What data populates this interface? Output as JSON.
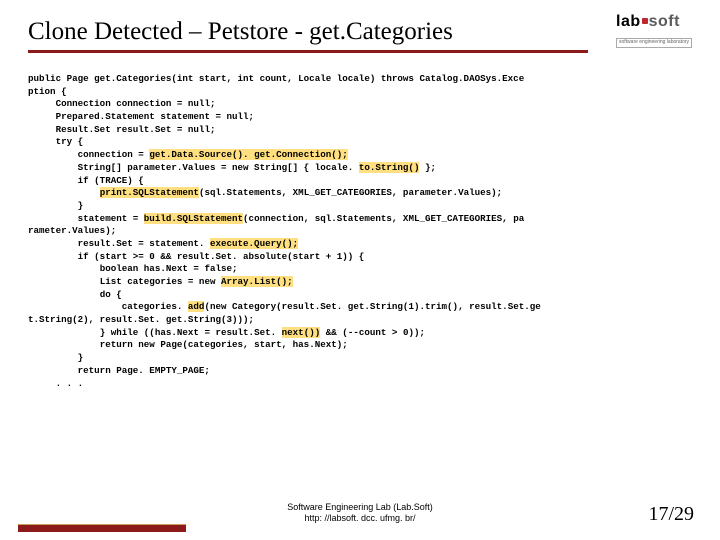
{
  "title": "Clone Detected – Petstore - get.Categories",
  "logo": {
    "lab": "lab",
    "soft": "soft",
    "sub": "software engineering laboratory"
  },
  "code": {
    "l1a": "public Page get.Categories(int start, int count, Locale locale) throws Catalog.DAOSys.Exce",
    "l1b": "ption {",
    "l2": "     Connection connection = null;",
    "l3": "     Prepared.Statement statement = null;",
    "l4": "     Result.Set result.Set = null;",
    "l5": "     try {",
    "l6a": "         connection = ",
    "l6h": "get.Data.Source(). get.Connection();",
    "l7a": "         String[] parameter.Values = new String[] { locale. ",
    "l7h": "to.String()",
    "l7b": " };",
    "l8": "         if (TRACE) {",
    "l9a": "             ",
    "l9h": "print.SQLStatement",
    "l9b": "(sql.Statements, XML_GET_CATEGORIES, parameter.Values);",
    "l10": "         }",
    "l11a": "         statement = ",
    "l11h": "build.SQLStatement",
    "l11b": "(connection, sql.Statements, XML_GET_CATEGORIES, pa",
    "l11c": "rameter.Values);",
    "l12a": "         result.Set = statement. ",
    "l12h": "execute.Query();",
    "l13": "         if (start >= 0 && result.Set. absolute(start + 1)) {",
    "l14": "             boolean has.Next = false;",
    "l15a": "             List categories = new ",
    "l15h": "Array.List();",
    "l16": "             do {",
    "l17a": "                 categories. ",
    "l17h": "add",
    "l17b": "(new Category(result.Set. get.String(1).trim(), result.Set.ge",
    "l17c": "t.String(2), result.Set. get.String(3)));",
    "l18a": "             } while ((has.Next = result.Set. ",
    "l18h": "next())",
    "l18b": " && (--count > 0));",
    "l19": "             return new Page(categories, start, has.Next);",
    "l20": "         }",
    "l21": "         return Page. EMPTY_PAGE;",
    "l22": "     . . ."
  },
  "footer": {
    "line1": "Software Engineering Lab (Lab.Soft)",
    "line2": "http: //labsoft. dcc. ufmg. br/"
  },
  "pagenum": "17/29"
}
